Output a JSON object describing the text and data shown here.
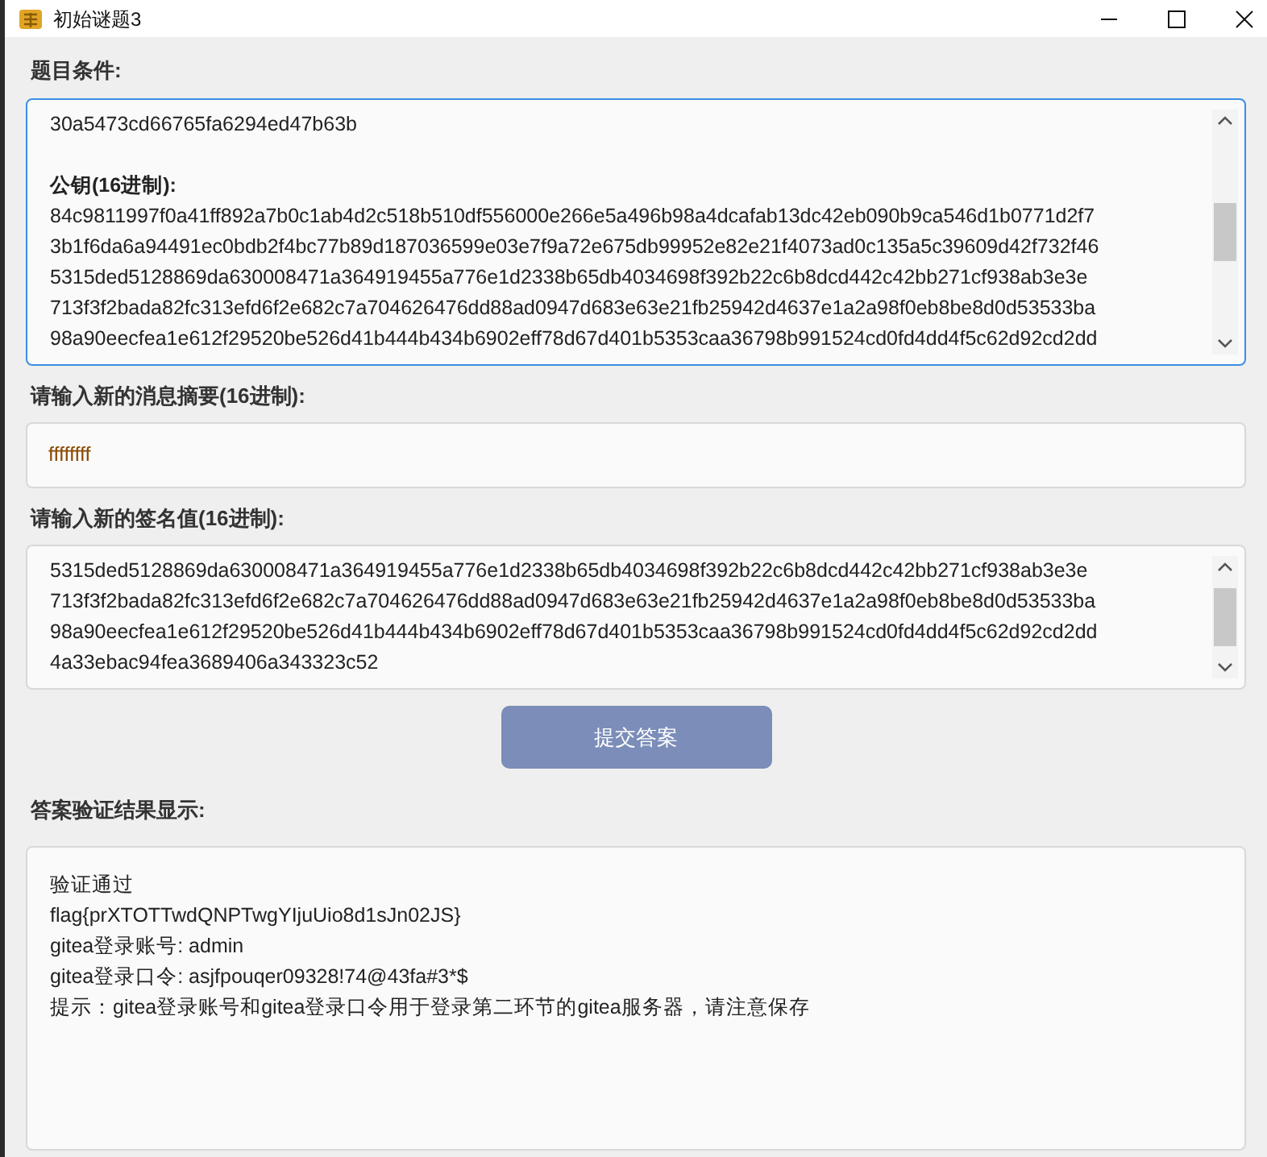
{
  "window": {
    "title": "初始谜题3"
  },
  "sections": [
    {
      "label": "题目条件:",
      "kind": "textarea",
      "focused": true,
      "lines": [
        {
          "kind": "text",
          "text": "30a5473cd66765fa6294ed47b63b"
        },
        {
          "kind": "heading",
          "text": "公钥(16进制):"
        },
        {
          "kind": "text",
          "text": "84c9811997f0a41ff892a7b0c1ab4d2c518b510df556000e266e5a496b98a4dcafab13dc42eb090b9ca546d1b0771d2f7"
        },
        {
          "kind": "text",
          "text": "3b1f6da6a94491ec0bdb2f4bc77b89d187036599e03e7f9a72e675db99952e82e21f4073ad0c135a5c39609d42f732f46"
        },
        {
          "kind": "text",
          "text": "5315ded5128869da630008471a364919455a776e1d2338b65db4034698f392b22c6b8dcd442c42bb271cf938ab3e3e"
        },
        {
          "kind": "text",
          "text": "713f3f2bada82fc313efd6f2e682c7a704626476dd88ad0947d683e63e21fb25942d4637e1a2a98f0eb8be8d0d53533ba"
        },
        {
          "kind": "text",
          "text": "98a90eecfea1e612f29520be526d41b444b434b6902eff78d67d401b5353caa36798b991524cd0fd4dd4f5c62d92cd2dd"
        }
      ]
    },
    {
      "label": "请输入新的消息摘要(16进制):",
      "kind": "input",
      "value": "ffffffff"
    },
    {
      "label": "请输入新的签名值(16进制):",
      "kind": "textarea",
      "focused": false,
      "lines": [
        {
          "kind": "text",
          "text": "5315ded5128869da630008471a364919455a776e1d2338b65db4034698f392b22c6b8dcd442c42bb271cf938ab3e3e"
        },
        {
          "kind": "text",
          "text": "713f3f2bada82fc313efd6f2e682c7a704626476dd88ad0947d683e63e21fb25942d4637e1a2a98f0eb8be8d0d53533ba"
        },
        {
          "kind": "text",
          "text": "98a90eecfea1e612f29520be526d41b444b434b6902eff78d67d401b5353caa36798b991524cd0fd4dd4f5c62d92cd2dd"
        },
        {
          "kind": "text",
          "text": "4a33ebac94fea3689406a343323c52"
        }
      ]
    }
  ],
  "submit_button": "提交答案",
  "result": {
    "label": "答案验证结果显示:",
    "lines": [
      "验证通过",
      "flag{prXTOTTwdQNPTwgYIjuUio8d1sJn02JS}",
      "gitea登录账号: admin",
      "gitea登录口令: asjfpouqer09328!74@43fa#3*$",
      "提示：gitea登录账号和gitea登录口令用于登录第二环节的gitea服务器，请注意保存"
    ]
  }
}
